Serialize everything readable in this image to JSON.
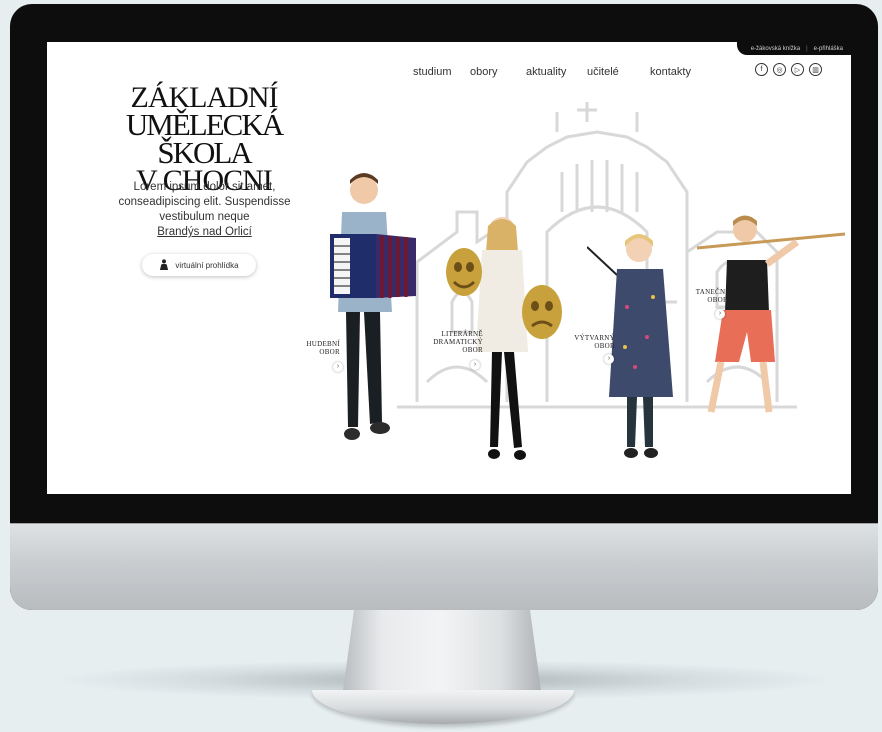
{
  "top_links": [
    "e-žákovská knížka",
    "e-přihláška"
  ],
  "nav": [
    "studium",
    "obory",
    "aktuality",
    "učitelé",
    "kontakty"
  ],
  "social": [
    {
      "icon": "facebook-icon",
      "glyph": "f"
    },
    {
      "icon": "instagram-icon",
      "glyph": "◎"
    },
    {
      "icon": "youtube-icon",
      "glyph": "▷"
    },
    {
      "icon": "gallery-icon",
      "glyph": "▥"
    }
  ],
  "logo": {
    "line1": "ZÁKLADNÍ",
    "line2": "UMĚLECKÁ ŠKOLA",
    "line3": "V CHOCNI"
  },
  "intro": {
    "text": "Lorem ipsum dolor sit amet, conseadipiscing elit. Suspendisse vestibulum neque",
    "city": "Brandýs nad Orlicí"
  },
  "tour_button": "virtuální prohlídka",
  "fields": [
    {
      "line1": "HUDEBNÍ",
      "line2": "OBOR",
      "line3": ""
    },
    {
      "line1": "LITERÁRNĚ",
      "line2": "DRAMATICKÝ",
      "line3": "OBOR"
    },
    {
      "line1": "VÝTVARNÝ",
      "line2": "OBOR",
      "line3": ""
    },
    {
      "line1": "TANEČNÍ",
      "line2": "OBOR",
      "line3": ""
    }
  ],
  "colors": {
    "accordion": "#2a3a8c",
    "mask": "#c8a13c",
    "dress": "#3e4a6b",
    "dancer_pants": "#e86e58"
  }
}
